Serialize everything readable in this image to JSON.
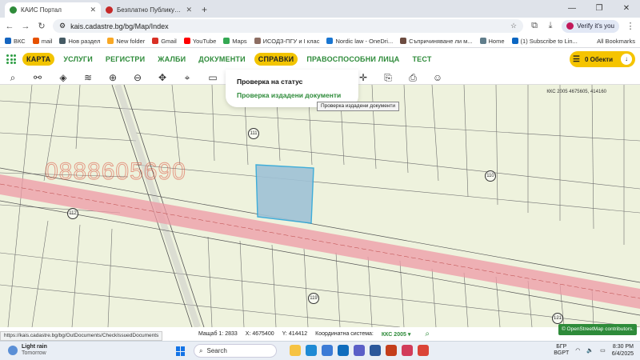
{
  "browser": {
    "tabs": [
      {
        "title": "КАИС Портал",
        "active": true,
        "color": "#2e8b3a"
      },
      {
        "title": "Безплатно Публикуване на Об...",
        "active": false,
        "color": "#c62828"
      }
    ],
    "new_tab": "+",
    "url": "kais.cadastre.bg/bg/Map/Index",
    "verify_label": "Verify it's you",
    "bookmarks": [
      {
        "label": "ВКС",
        "color": "#1565c0"
      },
      {
        "label": "mail",
        "color": "#e65100"
      },
      {
        "label": "Нов раздел",
        "color": "#455a64"
      },
      {
        "label": "New folder",
        "color": "#f9a825"
      },
      {
        "label": "Gmail",
        "color": "#d93025"
      },
      {
        "label": "YouTube",
        "color": "#ff0000"
      },
      {
        "label": "Maps",
        "color": "#34a853"
      },
      {
        "label": "ИСОДЗ-ПГУ и I клас",
        "color": "#8d6e63"
      },
      {
        "label": "Nordic law - OneDri...",
        "color": "#1976d2"
      },
      {
        "label": "Съпричиняване ли м...",
        "color": "#6d4c41"
      },
      {
        "label": "Home",
        "color": "#607d8b"
      },
      {
        "label": "(1) Subscribe to Lin...",
        "color": "#0a66c2"
      }
    ],
    "all_bookmarks": "All Bookmarks"
  },
  "menu": {
    "items": [
      {
        "label": "КАРТА",
        "active": true
      },
      {
        "label": "УСЛУГИ",
        "active": false
      },
      {
        "label": "РЕГИСТРИ",
        "active": false
      },
      {
        "label": "ЖАЛБИ",
        "active": false
      },
      {
        "label": "ДОКУМЕНТИ",
        "active": false
      },
      {
        "label": "СПРАВКИ",
        "active": true
      },
      {
        "label": "ПРАВОСПОСОБНИ ЛИЦА",
        "active": false
      },
      {
        "label": "ТЕСТ",
        "active": false
      }
    ],
    "objects_label": "0 Обекти"
  },
  "dropdown": {
    "item1": "Проверка на статус",
    "item2": "Проверка издадени документи",
    "tooltip": "Проверка издадени документи"
  },
  "map": {
    "crs_label": "ККС 2005 4675605, 414160",
    "watermark": "0888605690",
    "parcels": [
      {
        "num": "111"
      },
      {
        "num": "110"
      },
      {
        "num": "112"
      },
      {
        "num": "119"
      },
      {
        "num": "121"
      }
    ]
  },
  "status": {
    "hover_url": "https://kais.cadastre.bg/bg/OutDocuments/CheckIssuedDocuments",
    "scale_label": "Мащаб 1:",
    "scale_value": "2833",
    "x_label": "X:",
    "x_value": "4675400",
    "y_label": "Y:",
    "y_value": "414412",
    "crs_label": "Координатна система:",
    "crs_value": "ККС 2005",
    "osm": "© OpenStreetMap contributors."
  },
  "taskbar": {
    "weather_title": "Light rain",
    "weather_sub": "Tomorrow",
    "search": "Search",
    "lang1": "БГР",
    "lang2": "BGPT",
    "time": "8:30 PM",
    "date": "6/4/2025"
  },
  "colors": {
    "brand_green": "#2e8b3a",
    "accent_yellow": "#f5c400",
    "road_pink": "#ee9aa6",
    "selection_blue": "#9fc2d6"
  }
}
